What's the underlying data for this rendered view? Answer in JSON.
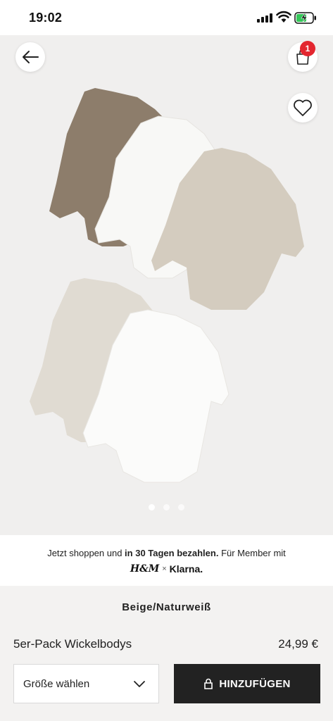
{
  "status_bar": {
    "time": "19:02"
  },
  "hero": {
    "active_image": 0,
    "image_count": 3
  },
  "bag": {
    "count": "1"
  },
  "klarna": {
    "text_before": "Jetzt shoppen und ",
    "text_bold": "in 30 Tagen bezahlen.",
    "text_after": " Für Member mit",
    "brand_hm": "H&M",
    "brand_times": "×",
    "brand_klarna": "Klarna."
  },
  "product": {
    "color_name": "Beige/Naturweiß",
    "title": "5er-Pack Wickelbodys",
    "price": "24,99 €"
  },
  "actions": {
    "size_label": "Größe wählen",
    "add_label": "HINZUFÜGEN"
  },
  "colors": {
    "badge": "#e3262f",
    "button_bg": "#222222",
    "image_bg": "#f0efee"
  },
  "icons": {
    "back": "arrow-left-icon",
    "bag": "shopping-bag-icon",
    "favorite": "heart-icon",
    "dropdown": "chevron-down-icon",
    "lock": "lock-icon"
  }
}
